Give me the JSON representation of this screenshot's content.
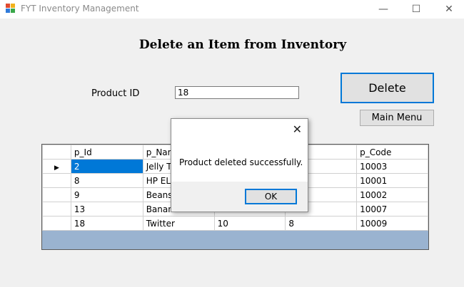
{
  "window": {
    "title": "FYT Inventory Management",
    "icon": "app-icon",
    "controls": {
      "minimize": "—",
      "maximize": "☐",
      "close": "✕"
    }
  },
  "form": {
    "heading": "Delete an Item from Inventory",
    "product_id_label": "Product ID",
    "product_id_value": "18",
    "delete_label": "Delete",
    "main_menu_label": "Main Menu"
  },
  "grid": {
    "columns": [
      "p_Id",
      "p_Nam",
      "",
      "ce",
      "p_Code"
    ],
    "rows": [
      [
        "2",
        "Jelly Te",
        "",
        "",
        "10003"
      ],
      [
        "8",
        "HP ELIT",
        "",
        "0",
        "10001"
      ],
      [
        "9",
        "Beans",
        "",
        "",
        "10002"
      ],
      [
        "13",
        "Banana",
        "24",
        "50",
        "10007"
      ],
      [
        "18",
        "Twitter",
        "10",
        "8",
        "10009"
      ]
    ],
    "row4_ellipsis": "...",
    "selected_row": 0,
    "colors": {
      "selection": "#0078d7",
      "background": "#9ab3d0"
    }
  },
  "dialog": {
    "message": "Product deleted successfully.",
    "ok_label": "OK",
    "close_glyph": "✕"
  },
  "colors": {
    "accent": "#0078d7",
    "window_bg": "#f0f0f0"
  }
}
